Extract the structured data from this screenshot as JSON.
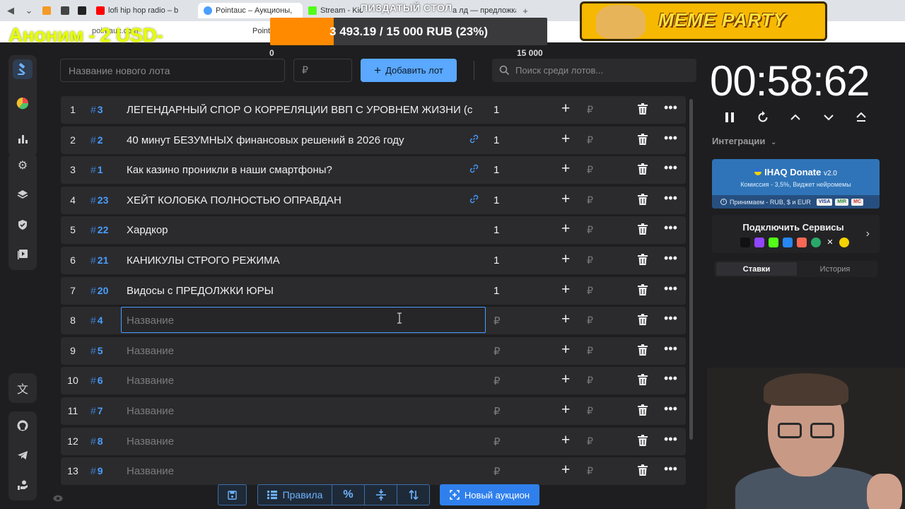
{
  "browser": {
    "tabs": [
      {
        "label": "lofi hip hop radio – b",
        "icon": "youtube-icon",
        "color": "#ff0000"
      },
      {
        "label": "Pointauc – Аукционы, ",
        "icon": "pointauc-icon",
        "color": "#4a9eff",
        "active": true
      },
      {
        "label": "Stream - Kic",
        "icon": "kick-icon",
        "color": "#53fc18"
      },
      {
        "label": "а лд — предложка",
        "icon": "page-icon",
        "color": "#888888"
      }
    ],
    "address": "pointauc.com",
    "address_prefix": "Point"
  },
  "overlay": {
    "donor_line": "Аноним - 2 USD-",
    "goal_title": "ПИЗДАТЫЙ СТОЛ",
    "goal_text": "3 493.19 / 15 000 RUB (23%)",
    "goal_progress": 0.23,
    "goal_min": "0",
    "goal_max": "15 000",
    "banner": "MEME PARTY",
    "corner": "10"
  },
  "toolbar": {
    "new_lot_placeholder": "Название нового лота",
    "amount_placeholder": "₽",
    "add_lot_label": "Добавить лот",
    "search_placeholder": "Поиск среди лотов..."
  },
  "lots": [
    {
      "num": "1",
      "id": "3",
      "name": "ЛЕГЕНДАРНЫЙ СПОР О КОРРЕЛЯЦИИ ВВП С УРОВНЕМ ЖИЗНИ (с",
      "amount": "1",
      "link": false
    },
    {
      "num": "2",
      "id": "2",
      "name": "40 минут БЕЗУМНЫХ финансовых решений в 2026 году",
      "amount": "1",
      "link": true
    },
    {
      "num": "3",
      "id": "1",
      "name": "Как казино проникли в наши смартфоны?",
      "amount": "1",
      "link": true
    },
    {
      "num": "4",
      "id": "23",
      "name": "ХЕЙТ КОЛОБКА ПОЛНОСТЬЮ ОПРАВДАН",
      "amount": "1",
      "link": true
    },
    {
      "num": "5",
      "id": "22",
      "name": "Хардкор",
      "amount": "1",
      "link": false
    },
    {
      "num": "6",
      "id": "21",
      "name": "КАНИКУЛЫ СТРОГО РЕЖИМА",
      "amount": "1",
      "link": false
    },
    {
      "num": "7",
      "id": "20",
      "name": "Видосы с ПРЕДОЛЖКИ ЮРЫ",
      "amount": "1",
      "link": false
    },
    {
      "num": "8",
      "id": "4",
      "name": "Название",
      "amount": "₽",
      "placeholder": true,
      "editing": true
    },
    {
      "num": "9",
      "id": "5",
      "name": "Название",
      "amount": "₽",
      "placeholder": true
    },
    {
      "num": "10",
      "id": "6",
      "name": "Название",
      "amount": "₽",
      "placeholder": true
    },
    {
      "num": "11",
      "id": "7",
      "name": "Название",
      "amount": "₽",
      "placeholder": true
    },
    {
      "num": "12",
      "id": "8",
      "name": "Название",
      "amount": "₽",
      "placeholder": true
    },
    {
      "num": "13",
      "id": "9",
      "name": "Название",
      "amount": "₽",
      "placeholder": true
    }
  ],
  "row_labels": {
    "hash": "#",
    "rub": "₽",
    "plus": "+",
    "more": "•••"
  },
  "bottom_bar": {
    "rules_label": "Правила",
    "percent_label": "%",
    "new_auction_label": "Новый аукцион"
  },
  "timer": {
    "value": "00:58:62"
  },
  "integrations": {
    "label": "Интеграции"
  },
  "donate": {
    "title": "IHAQ Donate",
    "version": "v2.0",
    "subtitle": "Комиссия - 3,5%, Виджет нейромемы",
    "footer": "Принимаем - RUB, $ и EUR",
    "payments": [
      "VISA",
      "MIR",
      "MC"
    ]
  },
  "services": {
    "title": "Подключить Сервисы"
  },
  "history_tabs": {
    "bets": "Ставки",
    "history": "История"
  },
  "colors": {
    "accent": "#4a9eff",
    "button": "#5aa8ff",
    "row_bg": "#2b2b2e",
    "page_bg": "#1e1e20",
    "goal": "#ff8a00"
  }
}
